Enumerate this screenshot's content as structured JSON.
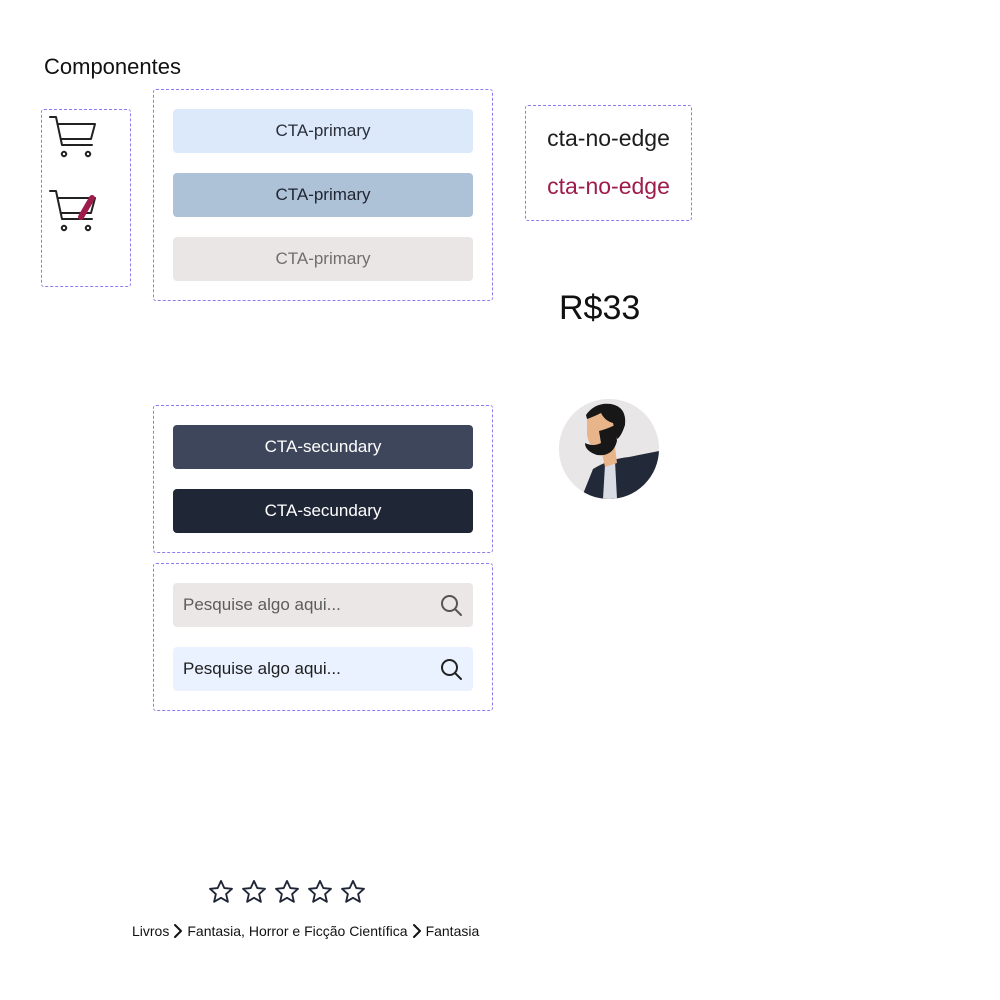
{
  "page": {
    "title": "Componentes"
  },
  "colors": {
    "primary_light": "#dbe9fb",
    "primary_mid": "#adc1d7",
    "primary_disabled": "#eae6e5",
    "secondary_1": "#3e465c",
    "secondary_2": "#1f2636",
    "accent": "#9e1c4b",
    "search_bg_1": "#ebe7e6",
    "search_bg_2": "#eaf2ff",
    "box_border": "#8a7df0"
  },
  "icons": {
    "cart": "cart-icon",
    "cart_edit": "cart-edit-icon",
    "search": "search-icon",
    "star": "star-outline-icon",
    "chevron": "chevron-right-icon"
  },
  "primary_buttons": [
    {
      "label": "CTA-primary"
    },
    {
      "label": "CTA-primary"
    },
    {
      "label": "CTA-primary"
    }
  ],
  "secondary_buttons": [
    {
      "label": "CTA-secundary"
    },
    {
      "label": "CTA-secundary"
    }
  ],
  "no_edge_buttons": [
    {
      "label": "cta-no-edge"
    },
    {
      "label": "cta-no-edge"
    }
  ],
  "price": "R$33",
  "search_fields": [
    {
      "placeholder": "Pesquise algo aqui...",
      "value": ""
    },
    {
      "placeholder": "Pesquise algo aqui...",
      "value": ""
    }
  ],
  "rating": {
    "value": 0,
    "max": 5
  },
  "breadcrumb": [
    "Livros",
    "Fantasia, Horror e Ficção Científica",
    "Fantasia"
  ]
}
